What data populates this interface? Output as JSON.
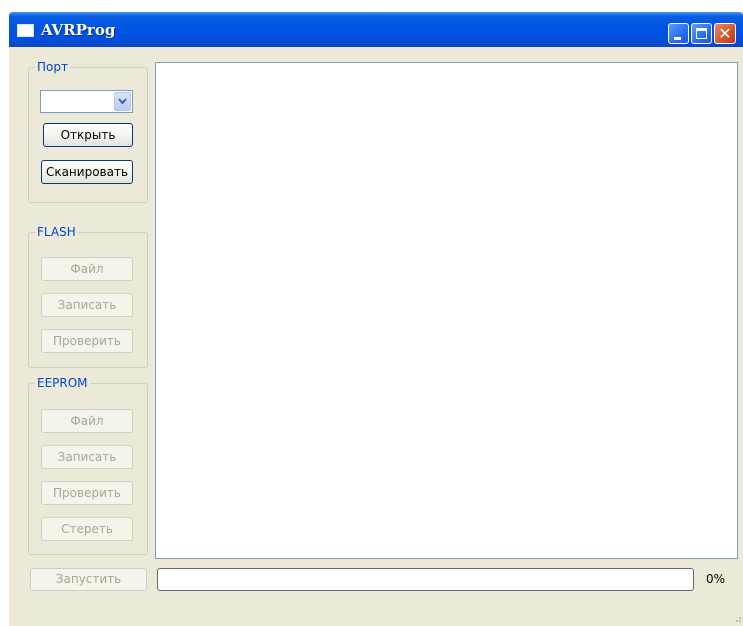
{
  "window": {
    "title": "AVRProg"
  },
  "port": {
    "group_label": "Порт",
    "selected_port": "",
    "open_label": "Открыть",
    "scan_label": "Сканировать"
  },
  "flash": {
    "group_label": "FLASH",
    "file_label": "Файл",
    "write_label": "Записать",
    "verify_label": "Проверить"
  },
  "eeprom": {
    "group_label": "EEPROM",
    "file_label": "Файл",
    "write_label": "Записать",
    "verify_label": "Проверить",
    "erase_label": "Стереть"
  },
  "footer": {
    "run_label": "Запустить",
    "progress_value": 0,
    "progress_text": "0%"
  },
  "colors": {
    "titlebar": "#0054e3",
    "group_label": "#0046d5",
    "window_bg": "#ece9d8",
    "disabled_text": "#a6a598"
  },
  "icons": {
    "window_icon": "app-window-icon",
    "minimize": "minimize-icon",
    "maximize": "maximize-icon",
    "close": "close-icon",
    "dropdown": "chevron-down-icon"
  }
}
